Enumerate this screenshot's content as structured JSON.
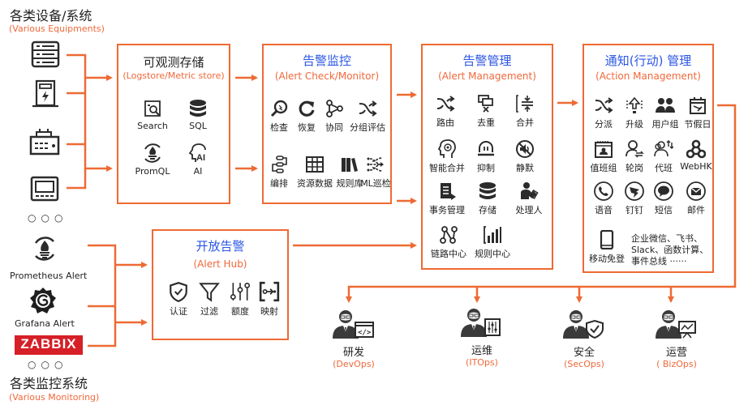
{
  "left_top": {
    "title": "各类设备/系统",
    "subtitle": "(Various Equipments)"
  },
  "left_bottom": {
    "title": "各类监控系统",
    "subtitle": "(Various Monitoring)",
    "sources": [
      {
        "label": "Prometheus Alert",
        "icon": "prometheus-icon"
      },
      {
        "label": "Grafana Alert",
        "icon": "grafana-icon"
      },
      {
        "label": "ZABBIX",
        "icon": "zabbix-logo"
      }
    ]
  },
  "more_dots": "○○○",
  "storage": {
    "title": "可观测存储",
    "subtitle": "(Logstore/Metric store)",
    "items": [
      {
        "label": "Search",
        "icon": "search-doc-icon"
      },
      {
        "label": "SQL",
        "icon": "database-icon"
      },
      {
        "label": "PromQL",
        "icon": "prometheus-icon"
      },
      {
        "label": "AI",
        "icon": "ai-head-icon"
      }
    ]
  },
  "monitor": {
    "title": "告警监控",
    "subtitle": "(Alert Check/Monitor)",
    "items": [
      {
        "label": "检查",
        "icon": "magnifier-icon"
      },
      {
        "label": "恢复",
        "icon": "refresh-icon"
      },
      {
        "label": "协同",
        "icon": "share-nodes-icon"
      },
      {
        "label": "分组评估",
        "icon": "shuffle-icon"
      },
      {
        "label": "编排",
        "icon": "orchestrate-icon"
      },
      {
        "label": "资源数据",
        "icon": "table-icon"
      },
      {
        "label": "规则库",
        "icon": "books-icon"
      },
      {
        "label": "ML巡检",
        "icon": "ml-flow-icon"
      }
    ]
  },
  "management": {
    "title": "告警管理",
    "subtitle": "(Alert Management)",
    "items": [
      {
        "label": "路由",
        "icon": "shuffle-icon"
      },
      {
        "label": "去重",
        "icon": "dedupe-icon"
      },
      {
        "label": "合并",
        "icon": "merge-icon"
      },
      {
        "label": "智能合并",
        "icon": "brain-head-icon"
      },
      {
        "label": "抑制",
        "icon": "suppress-icon"
      },
      {
        "label": "静默",
        "icon": "mute-icon"
      },
      {
        "label": "事务管理",
        "icon": "incident-icon"
      },
      {
        "label": "存储",
        "icon": "database-icon"
      },
      {
        "label": "处理人",
        "icon": "person-reading-icon"
      },
      {
        "label": "链路中心",
        "icon": "trace-icon"
      },
      {
        "label": "规则中心",
        "icon": "bar-rules-icon"
      }
    ]
  },
  "action": {
    "title": "通知(行动) 管理",
    "subtitle": "(Action Management)",
    "items": [
      {
        "label": "分派",
        "icon": "shuffle-icon"
      },
      {
        "label": "升级",
        "icon": "upgrade-icon"
      },
      {
        "label": "用户组",
        "icon": "user-group-icon"
      },
      {
        "label": "节假日",
        "icon": "calendar-icon"
      },
      {
        "label": "值班组",
        "icon": "duty-calendar-icon"
      },
      {
        "label": "轮岗",
        "icon": "rotate-user-icon"
      },
      {
        "label": "代班",
        "icon": "substitute-icon"
      },
      {
        "label": "WebHK",
        "icon": "webhook-icon"
      },
      {
        "label": "语音",
        "icon": "phone-icon"
      },
      {
        "label": "钉钉",
        "icon": "dingtalk-icon"
      },
      {
        "label": "短信",
        "icon": "sms-icon"
      },
      {
        "label": "邮件",
        "icon": "mail-icon"
      },
      {
        "label": "移动免登",
        "icon": "mobile-icon"
      }
    ],
    "more_channels": [
      "企业微信、飞书、",
      "Slack、函数计算、",
      "事件总线 ······"
    ]
  },
  "hub": {
    "title": "开放告警",
    "subtitle": "(Alert Hub)",
    "items": [
      {
        "label": "认证",
        "icon": "shield-check-icon"
      },
      {
        "label": "过滤",
        "icon": "filter-icon"
      },
      {
        "label": "额度",
        "icon": "sliders-icon"
      },
      {
        "label": "映射",
        "icon": "mapping-icon"
      }
    ]
  },
  "ops": [
    {
      "cn": "研发",
      "en": "(DevOps)",
      "icon": "developer-icon"
    },
    {
      "cn": "运维",
      "en": "(ITOps)",
      "icon": "operator-icon"
    },
    {
      "cn": "安全",
      "en": "(SecOps)",
      "icon": "security-person-icon"
    },
    {
      "cn": "运营",
      "en": "( BizOps)",
      "icon": "business-person-icon"
    }
  ],
  "colors": {
    "accent": "#ee6a33",
    "title_blue": "#2a55e5",
    "zabbix_red": "#d61f26",
    "icon": "#2b2b2b"
  }
}
